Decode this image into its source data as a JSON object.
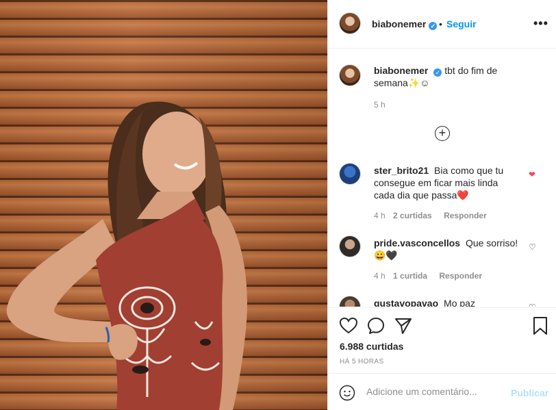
{
  "post": {
    "username": "biabonemer",
    "follow_dot": "•",
    "follow_label": "Seguir",
    "more_label": "•••"
  },
  "caption": {
    "username": "biabonemer",
    "text": "tbt do fim de semana✨☺",
    "time": "5 h"
  },
  "load_more_label": "+",
  "comments": [
    {
      "username": "ster_brito21",
      "text": "Bia como que tu consegue em ficar mais linda cada dia que passa❤️",
      "time": "4 h",
      "likes": "2 curtidas",
      "reply": "Responder",
      "liked": true
    },
    {
      "username": "pride.vasconcellos",
      "text": "Que sorriso! 😀🖤",
      "time": "4 h",
      "likes": "1 curtida",
      "reply": "Responder",
      "liked": false
    },
    {
      "username": "gustavopavao",
      "text": "Mo paz",
      "liked": false
    }
  ],
  "actions": {
    "like_icon": "heart-outline",
    "comment_icon": "comment-bubble",
    "share_icon": "paper-plane",
    "save_icon": "bookmark"
  },
  "likes_count": "6.988 curtidas",
  "time_ago": "HÁ 5 HORAS",
  "add_comment": {
    "placeholder": "Adicione um comentário...",
    "publish_label": "Publicar"
  },
  "colors": {
    "accent": "#0095f6",
    "verified": "#3897f0",
    "liked_heart": "#ed4956",
    "publish_disabled": "#b2dffc"
  }
}
